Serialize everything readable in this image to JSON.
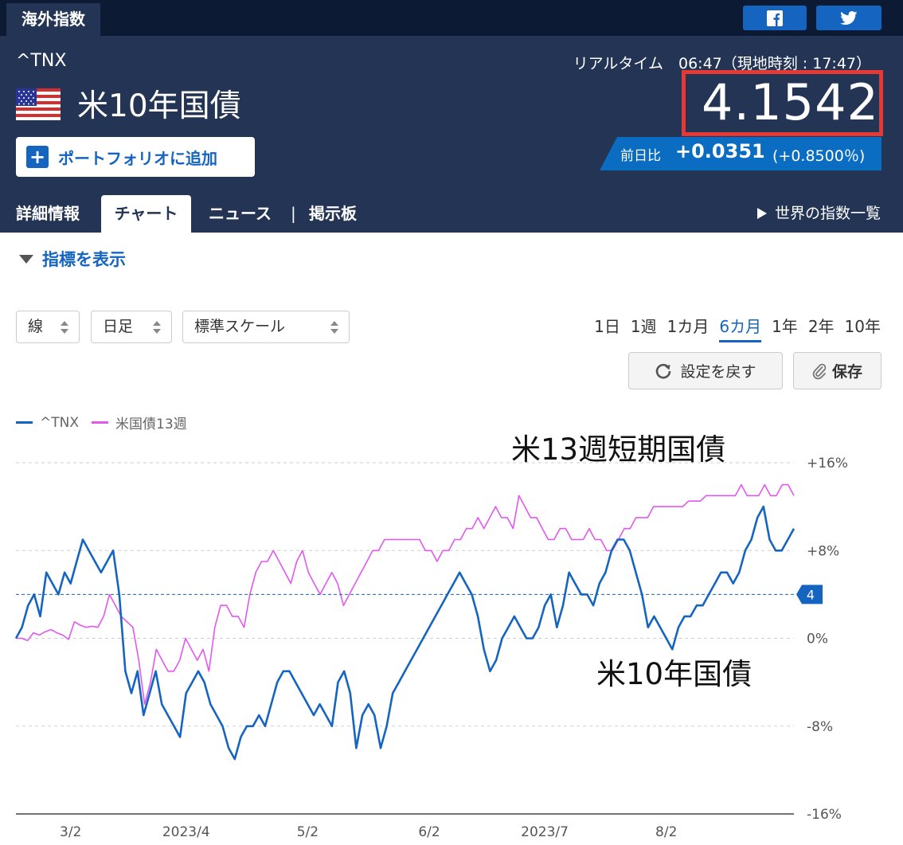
{
  "header": {
    "section_tab": "海外指数",
    "social": [
      "facebook-icon",
      "twitter-icon"
    ],
    "ticker": "^TNX",
    "name": "米10年国債",
    "flag": "us-flag-icon",
    "portfolio_button": "ポートフォリオに追加",
    "realtime": "リアルタイム　06:47（現地時刻 : 17:47）",
    "price": "4.1542",
    "change_label": "前日比",
    "change_value": "+0.0351",
    "change_pct": "(+0.8500％)"
  },
  "tabs": [
    {
      "label": "詳細情報",
      "active": false
    },
    {
      "label": "チャート",
      "active": true
    },
    {
      "label": "ニュース",
      "active": false
    },
    {
      "label": "掲示板",
      "active": false
    }
  ],
  "tab_separator": "|",
  "world_link": "世界の指数一覧",
  "indicator_toggle": "指標を表示",
  "selects": {
    "type": "線",
    "period": "日足",
    "scale": "標準スケール"
  },
  "ranges": [
    {
      "label": "1日",
      "active": false
    },
    {
      "label": "1週",
      "active": false
    },
    {
      "label": "1カ月",
      "active": false
    },
    {
      "label": "6カ月",
      "active": true
    },
    {
      "label": "1年",
      "active": false
    },
    {
      "label": "2年",
      "active": false
    },
    {
      "label": "10年",
      "active": false
    }
  ],
  "buttons": {
    "reset": "設定を戻す",
    "save": "保存"
  },
  "annotations": {
    "short_term": "米13週短期国債",
    "ten_year": "米10年国債"
  },
  "colors": {
    "tnx": "#1565c0",
    "t13w": "#e357f0",
    "accent": "#1565c0",
    "price_box": "#e53935"
  },
  "chart_data": {
    "type": "line",
    "legend": [
      "^TNX",
      "米国債13週"
    ],
    "legend_position": "top-left",
    "y_ticks": [
      "+16%",
      "+8%",
      "0%",
      "-8%",
      "-16%"
    ],
    "y_range": [
      -16,
      16
    ],
    "grid": true,
    "x_ticks": [
      {
        "label": "3/2",
        "index": 9
      },
      {
        "label": "2023/4",
        "index": 28
      },
      {
        "label": "5/2",
        "index": 48
      },
      {
        "label": "6/2",
        "index": 68
      },
      {
        "label": "2023/7",
        "index": 87
      },
      {
        "label": "8/2",
        "index": 107
      }
    ],
    "current_marker": {
      "label": "4",
      "value": 4
    },
    "series": [
      {
        "name": "^TNX",
        "color": "#1565c0",
        "values": [
          0,
          1,
          3,
          4,
          2,
          6,
          5,
          4,
          6,
          5,
          7,
          9,
          8,
          7,
          6,
          7,
          8,
          4,
          -3,
          -5,
          -3,
          -7,
          -5,
          -3,
          -6,
          -7,
          -8,
          -9,
          -5,
          -4,
          -3,
          -4,
          -6,
          -7,
          -8,
          -10,
          -11,
          -9,
          -8,
          -8,
          -7,
          -8,
          -6,
          -4,
          -3,
          -3,
          -4,
          -5,
          -6,
          -7,
          -6,
          -7,
          -8,
          -4,
          -3,
          -5,
          -10,
          -7,
          -6,
          -7,
          -10,
          -8,
          -5,
          -4,
          -3,
          -2,
          -1,
          0,
          1,
          2,
          3,
          4,
          5,
          6,
          5,
          4,
          2,
          -1,
          -3,
          -2,
          0,
          1,
          2,
          1,
          0,
          0,
          1,
          3,
          4,
          1,
          3,
          6,
          5,
          4,
          4,
          3,
          5,
          6,
          8,
          9,
          9,
          8,
          6,
          4,
          1,
          2,
          1,
          0,
          -1,
          1,
          2,
          2,
          3,
          3,
          4,
          5,
          6,
          6,
          5,
          6,
          8,
          9,
          11,
          12,
          9,
          8,
          8,
          9,
          10
        ]
      },
      {
        "name": "米国債13週",
        "color": "#e357f0",
        "values": [
          0,
          0,
          -0.2,
          0.5,
          0.3,
          0.6,
          0.8,
          0.5,
          0.3,
          -0.1,
          1.5,
          1.2,
          1,
          1.1,
          1,
          2,
          4,
          3,
          2,
          1.5,
          1,
          -2,
          -6,
          -4,
          -1,
          -2,
          -3,
          -3,
          -2,
          0,
          -1,
          -2,
          -1,
          -3,
          1,
          3,
          3,
          2,
          2,
          1,
          4,
          6,
          7,
          7,
          8,
          7,
          6,
          5,
          7,
          8,
          6,
          5,
          4,
          5,
          6,
          5,
          3,
          4,
          5,
          6,
          7,
          8,
          8,
          9,
          9,
          9,
          9,
          9,
          9,
          9,
          8,
          8,
          7,
          8,
          8,
          9,
          9,
          10,
          10,
          11,
          10,
          11,
          12,
          11,
          11,
          10,
          13,
          12,
          11,
          11,
          10,
          9,
          9,
          10,
          10,
          9,
          9,
          9,
          10,
          9,
          9,
          8,
          8,
          9,
          10,
          10,
          11,
          11,
          11,
          12,
          12,
          12,
          12,
          12,
          12,
          12.5,
          12.5,
          12.5,
          13,
          13,
          13,
          13,
          13,
          13,
          14,
          13,
          13,
          13,
          14,
          13,
          13,
          14,
          14,
          13
        ]
      }
    ]
  }
}
